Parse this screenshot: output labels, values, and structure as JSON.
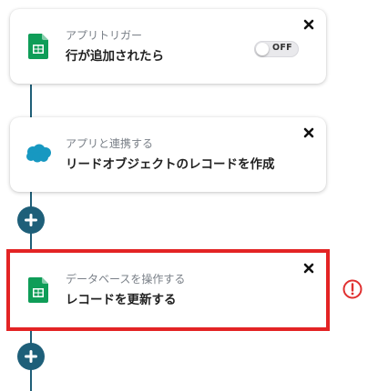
{
  "flow": {
    "steps": [
      {
        "subtitle": "アプリトリガー",
        "title": "行が追加されたら",
        "icon": "google-sheets-icon",
        "toggle_label": "OFF"
      },
      {
        "subtitle": "アプリと連携する",
        "title": "リードオブジェクトのレコードを作成",
        "icon": "salesforce-icon"
      },
      {
        "subtitle": "データベースを操作する",
        "title": "レコードを更新する",
        "icon": "google-sheets-icon",
        "status": "error"
      }
    ]
  },
  "colors": {
    "connector": "#1f5f78",
    "add_button": "#1e5f79",
    "selection_border": "#e32324",
    "error": "#e03030",
    "sheets_green": "#0f9d58",
    "salesforce_blue": "#1798c1"
  }
}
